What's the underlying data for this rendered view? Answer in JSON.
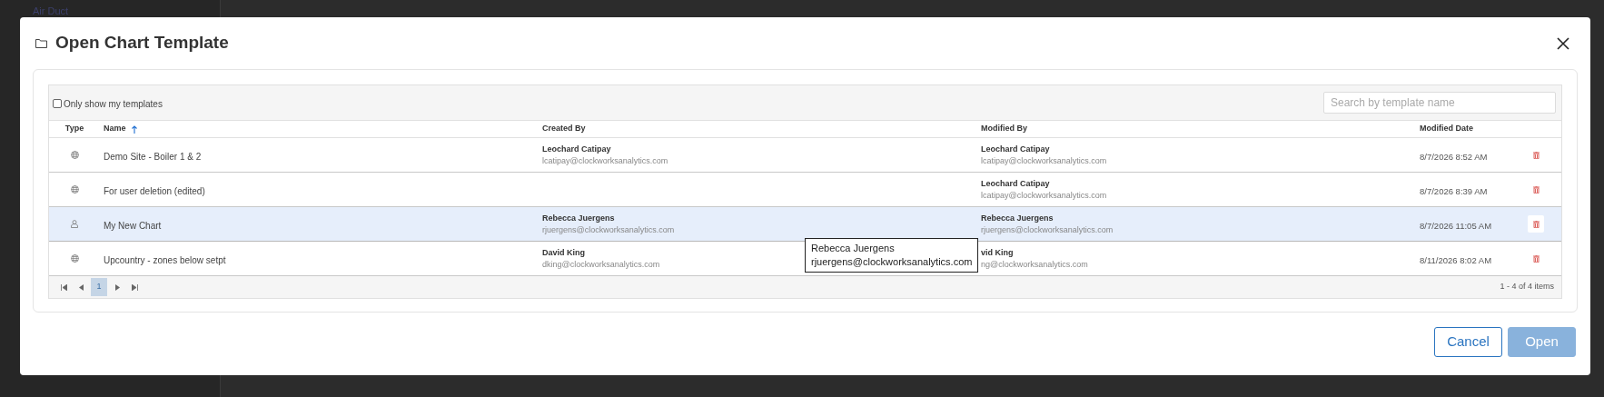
{
  "background": {
    "tree_item": "Air Duct"
  },
  "dialog": {
    "title": "Open Chart Template",
    "toolbar": {
      "checkbox": {
        "label": "Only show my templates",
        "checked": false
      },
      "search": {
        "placeholder": "Search by template name"
      }
    },
    "columns": [
      {
        "label": "Type"
      },
      {
        "label": "Name",
        "sorted": true
      },
      {
        "label": "Created By"
      },
      {
        "label": "Modified By"
      },
      {
        "label": "Modified Date"
      }
    ],
    "rows": [
      {
        "kind": "shared",
        "name": "Demo Site - Boiler 1 & 2",
        "created_by": {
          "name": "Leochard Catipay",
          "email": "lcatipay@clockworksanalytics.com"
        },
        "modified_by": {
          "name": "Leochard Catipay",
          "email": "lcatipay@clockworksanalytics.com"
        },
        "modified_date": "8/7/2026 8:52 AM",
        "selected": false
      },
      {
        "kind": "shared",
        "name": "For user deletion (edited)",
        "modified_by": {
          "name": "Leochard Catipay",
          "email": "lcatipay@clockworksanalytics.com"
        },
        "modified_date": "8/7/2026 8:39 AM",
        "selected": false
      },
      {
        "kind": "personal",
        "name": "My New Chart",
        "created_by": {
          "name": "Rebecca Juergens",
          "email": "rjuergens@clockworksanalytics.com"
        },
        "modified_by": {
          "name": "Rebecca Juergens",
          "email": "rjuergens@clockworksanalytics.com"
        },
        "modified_date": "8/7/2026 11:05 AM",
        "selected": true
      },
      {
        "kind": "shared",
        "name": "Upcountry - zones below setpt",
        "created_by": {
          "name": "David King",
          "email": "dking@clockworksanalytics.com"
        },
        "modified_by": {
          "name": "vid King",
          "email": "ng@clockworksanalytics.com"
        },
        "modified_date": "8/11/2026 8:02 AM",
        "selected": false
      }
    ],
    "pager": {
      "pages": [
        {
          "label": "1",
          "selected": true
        }
      ],
      "summary": "1 - 4 of 4 items"
    },
    "tooltip": {
      "name": "Rebecca Juergens",
      "email": "rjuergens@clockworksanalytics.com"
    },
    "buttons": [
      {
        "kind": "secondary",
        "label": "Cancel",
        "disabled": false
      },
      {
        "kind": "primary",
        "label": "Open",
        "disabled": true
      }
    ]
  }
}
